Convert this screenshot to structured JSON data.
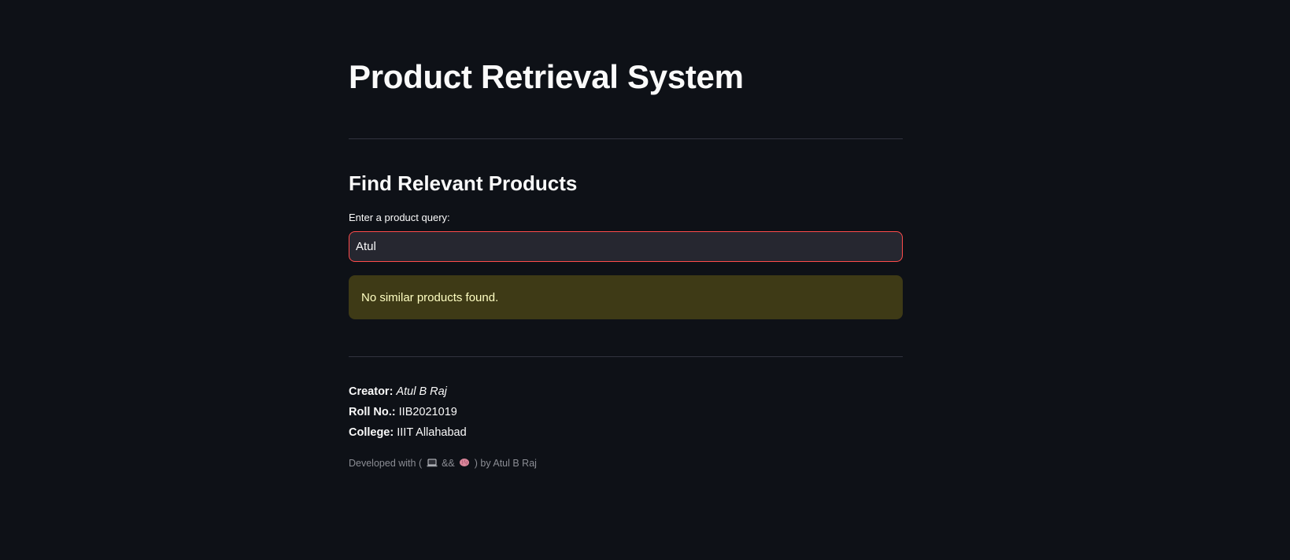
{
  "app": {
    "title": "Product Retrieval System"
  },
  "search": {
    "subheader": "Find Relevant Products",
    "label": "Enter a product query:",
    "value": "Atul"
  },
  "alert": {
    "message": "No similar products found."
  },
  "info": {
    "creator_label": "Creator:",
    "creator_value": "Atul B Raj",
    "roll_label": "Roll No.:",
    "roll_value": "IIB2021019",
    "college_label": "College:",
    "college_value": "IIIT Allahabad"
  },
  "footer": {
    "prefix": "Developed with (",
    "laptop_icon": "laptop-icon",
    "and": "&&",
    "brain_icon": "brain-icon",
    "suffix": ") by Atul B Raj"
  },
  "colors": {
    "background": "#0e1117",
    "input_border_focus": "#ff4b4b",
    "alert_background": "#3e3a16",
    "alert_text": "#ffffc2"
  }
}
